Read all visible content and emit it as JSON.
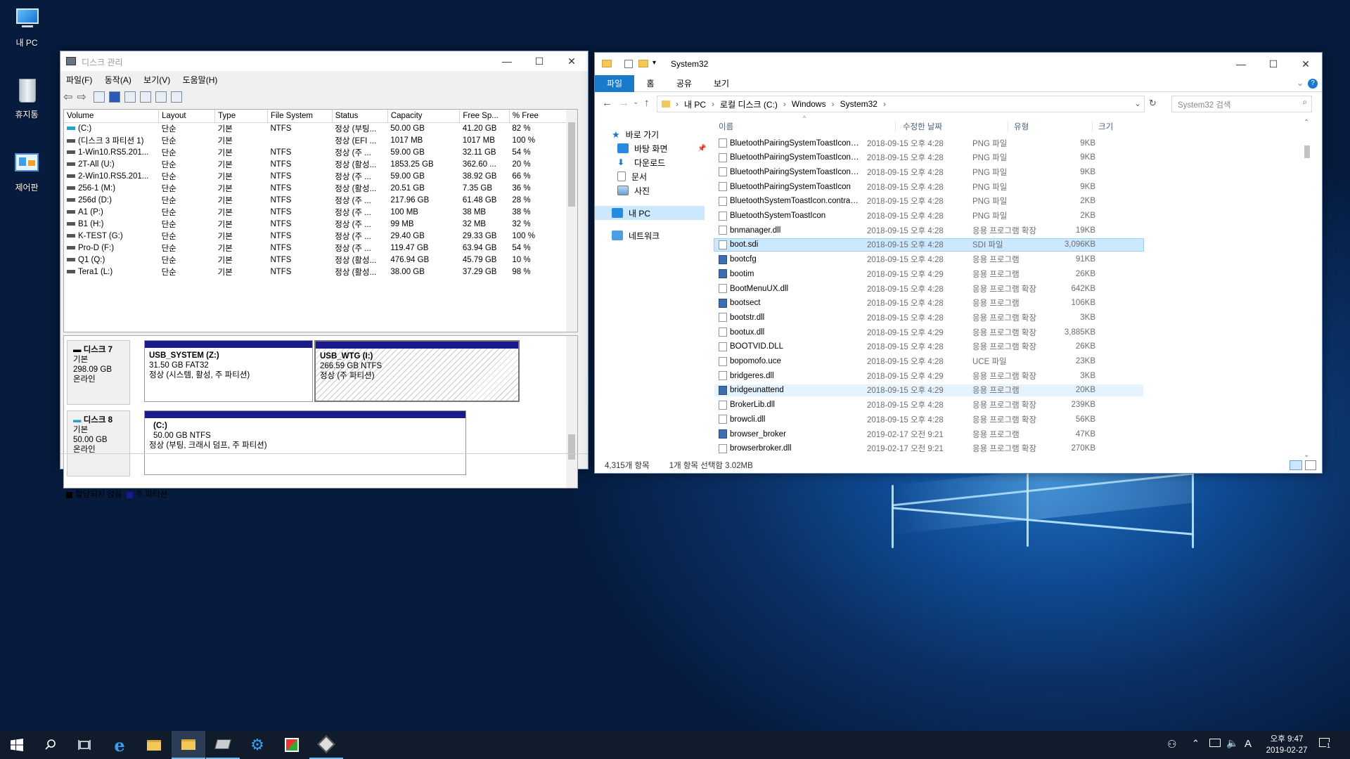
{
  "desktop": {
    "icons": [
      {
        "label": "내 PC",
        "icon": "computer-icon"
      },
      {
        "label": "휴지통",
        "icon": "recycle-bin-icon"
      },
      {
        "label": "제어판",
        "icon": "control-panel-icon"
      }
    ]
  },
  "disk_mgmt": {
    "title": "디스크 관리",
    "menu": [
      "파일(F)",
      "동작(A)",
      "보기(V)",
      "도움말(H)"
    ],
    "columns": [
      "Volume",
      "Layout",
      "Type",
      "File System",
      "Status",
      "Capacity",
      "Free Sp...",
      "% Free"
    ],
    "rows": [
      {
        "volume": "(C:)",
        "layout": "단순",
        "type": "기본",
        "fs": "NTFS",
        "status": "정상 (부팅...",
        "capacity": "50.00 GB",
        "free": "41.20 GB",
        "pct": "82 %"
      },
      {
        "volume": "(디스크 3 파티션 1)",
        "layout": "단순",
        "type": "기본",
        "fs": "",
        "status": "정상 (EFI ...",
        "capacity": "1017 MB",
        "free": "1017 MB",
        "pct": "100 %"
      },
      {
        "volume": "1-Win10.RS5.201...",
        "layout": "단순",
        "type": "기본",
        "fs": "NTFS",
        "status": "정상 (주 ...",
        "capacity": "59.00 GB",
        "free": "32.11 GB",
        "pct": "54 %"
      },
      {
        "volume": "2T-All (U:)",
        "layout": "단순",
        "type": "기본",
        "fs": "NTFS",
        "status": "정상 (활성...",
        "capacity": "1853.25 GB",
        "free": "362.60 ...",
        "pct": "20 %"
      },
      {
        "volume": "2-Win10.RS5.201...",
        "layout": "단순",
        "type": "기본",
        "fs": "NTFS",
        "status": "정상 (주 ...",
        "capacity": "59.00 GB",
        "free": "38.92 GB",
        "pct": "66 %"
      },
      {
        "volume": "256-1 (M:)",
        "layout": "단순",
        "type": "기본",
        "fs": "NTFS",
        "status": "정상 (활성...",
        "capacity": "20.51 GB",
        "free": "7.35 GB",
        "pct": "36 %"
      },
      {
        "volume": "256d (D:)",
        "layout": "단순",
        "type": "기본",
        "fs": "NTFS",
        "status": "정상 (주 ...",
        "capacity": "217.96 GB",
        "free": "61.48 GB",
        "pct": "28 %"
      },
      {
        "volume": "A1 (P:)",
        "layout": "단순",
        "type": "기본",
        "fs": "NTFS",
        "status": "정상 (주 ...",
        "capacity": "100 MB",
        "free": "38 MB",
        "pct": "38 %"
      },
      {
        "volume": "B1 (H:)",
        "layout": "단순",
        "type": "기본",
        "fs": "NTFS",
        "status": "정상 (주 ...",
        "capacity": "99 MB",
        "free": "32 MB",
        "pct": "32 %"
      },
      {
        "volume": "K-TEST (G:)",
        "layout": "단순",
        "type": "기본",
        "fs": "NTFS",
        "status": "정상 (주 ...",
        "capacity": "29.40 GB",
        "free": "29.33 GB",
        "pct": "100 %"
      },
      {
        "volume": "Pro-D (F:)",
        "layout": "단순",
        "type": "기본",
        "fs": "NTFS",
        "status": "정상 (주 ...",
        "capacity": "119.47 GB",
        "free": "63.94 GB",
        "pct": "54 %"
      },
      {
        "volume": "Q1 (Q:)",
        "layout": "단순",
        "type": "기본",
        "fs": "NTFS",
        "status": "정상 (활성...",
        "capacity": "476.94 GB",
        "free": "45.79 GB",
        "pct": "10 %"
      },
      {
        "volume": "Tera1 (L:)",
        "layout": "단순",
        "type": "기본",
        "fs": "NTFS",
        "status": "정상 (활성...",
        "capacity": "38.00 GB",
        "free": "37.29 GB",
        "pct": "98 %"
      }
    ],
    "disks": [
      {
        "name": "디스크 7",
        "kind": "기본",
        "size": "298.09 GB",
        "state": "온라인",
        "parts": [
          {
            "name": "USB_SYSTEM  (Z:)",
            "size": "31.50 GB FAT32",
            "status": "정상 (시스템, 활성, 주 파티션)"
          },
          {
            "name": "USB_WTG  (I:)",
            "size": "266.59 GB NTFS",
            "status": "정상 (주 파티션)"
          }
        ]
      },
      {
        "name": "디스크 8",
        "kind": "기본",
        "size": "50.00 GB",
        "state": "온라인",
        "parts": [
          {
            "name": "(C:)",
            "size": "50.00 GB NTFS",
            "status": "정상 (부팅, 크래시 덤프, 주 파티션)"
          }
        ]
      }
    ],
    "legend": [
      "할당되지 않음",
      "주 파티션"
    ],
    "colors": {
      "unallocated": "#000000",
      "primary": "#1a1a8c"
    }
  },
  "explorer": {
    "title": "System32",
    "ribbon_tabs": [
      "파일",
      "홈",
      "공유",
      "보기"
    ],
    "breadcrumb": [
      "내 PC",
      "로컬 디스크 (C:)",
      "Windows",
      "System32"
    ],
    "search_placeholder": "System32 검색",
    "nav": [
      {
        "label": "바로 가기",
        "icon": "star-icon"
      },
      {
        "label": "바탕 화면",
        "icon": "desktop-icon"
      },
      {
        "label": "다운로드",
        "icon": "download-icon"
      },
      {
        "label": "문서",
        "icon": "document-icon"
      },
      {
        "label": "사진",
        "icon": "picture-icon"
      },
      {
        "label": "내 PC",
        "icon": "computer-icon"
      },
      {
        "label": "네트워크",
        "icon": "network-icon"
      }
    ],
    "columns": [
      "이름",
      "수정한 날짜",
      "유형",
      "크기"
    ],
    "files": [
      {
        "name": "BluetoothPairingSystemToastIcon.contra...",
        "date": "2018-09-15 오후 4:28",
        "type": "PNG 파일",
        "size": "9KB"
      },
      {
        "name": "BluetoothPairingSystemToastIcon.contra...",
        "date": "2018-09-15 오후 4:28",
        "type": "PNG 파일",
        "size": "9KB"
      },
      {
        "name": "BluetoothPairingSystemToastIcon.contra...",
        "date": "2018-09-15 오후 4:28",
        "type": "PNG 파일",
        "size": "9KB"
      },
      {
        "name": "BluetoothPairingSystemToastIcon",
        "date": "2018-09-15 오후 4:28",
        "type": "PNG 파일",
        "size": "9KB"
      },
      {
        "name": "BluetoothSystemToastIcon.contrast-white",
        "date": "2018-09-15 오후 4:28",
        "type": "PNG 파일",
        "size": "2KB"
      },
      {
        "name": "BluetoothSystemToastIcon",
        "date": "2018-09-15 오후 4:28",
        "type": "PNG 파일",
        "size": "2KB"
      },
      {
        "name": "bnmanager.dll",
        "date": "2018-09-15 오후 4:28",
        "type": "응용 프로그램 확장",
        "size": "19KB"
      },
      {
        "name": "boot.sdi",
        "date": "2018-09-15 오후 4:28",
        "type": "SDI 파일",
        "size": "3,096KB"
      },
      {
        "name": "bootcfg",
        "date": "2018-09-15 오후 4:28",
        "type": "응용 프로그램",
        "size": "91KB"
      },
      {
        "name": "bootim",
        "date": "2018-09-15 오후 4:29",
        "type": "응용 프로그램",
        "size": "26KB"
      },
      {
        "name": "BootMenuUX.dll",
        "date": "2018-09-15 오후 4:28",
        "type": "응용 프로그램 확장",
        "size": "642KB"
      },
      {
        "name": "bootsect",
        "date": "2018-09-15 오후 4:28",
        "type": "응용 프로그램",
        "size": "106KB"
      },
      {
        "name": "bootstr.dll",
        "date": "2018-09-15 오후 4:28",
        "type": "응용 프로그램 확장",
        "size": "3KB"
      },
      {
        "name": "bootux.dll",
        "date": "2018-09-15 오후 4:29",
        "type": "응용 프로그램 확장",
        "size": "3,885KB"
      },
      {
        "name": "BOOTVID.DLL",
        "date": "2018-09-15 오후 4:28",
        "type": "응용 프로그램 확장",
        "size": "26KB"
      },
      {
        "name": "bopomofo.uce",
        "date": "2018-09-15 오후 4:28",
        "type": "UCE 파일",
        "size": "23KB"
      },
      {
        "name": "bridgeres.dll",
        "date": "2018-09-15 오후 4:29",
        "type": "응용 프로그램 확장",
        "size": "3KB"
      },
      {
        "name": "bridgeunattend",
        "date": "2018-09-15 오후 4:29",
        "type": "응용 프로그램",
        "size": "20KB"
      },
      {
        "name": "BrokerLib.dll",
        "date": "2018-09-15 오후 4:28",
        "type": "응용 프로그램 확장",
        "size": "239KB"
      },
      {
        "name": "browcli.dll",
        "date": "2018-09-15 오후 4:28",
        "type": "응용 프로그램 확장",
        "size": "56KB"
      },
      {
        "name": "browser_broker",
        "date": "2019-02-17 오전 9:21",
        "type": "응용 프로그램",
        "size": "47KB"
      },
      {
        "name": "browserbroker.dll",
        "date": "2019-02-17 오전 9:21",
        "type": "응용 프로그램 확장",
        "size": "270KB"
      }
    ],
    "selected_index": 7,
    "hover_index": 17,
    "status_count": "4,315개 항목",
    "status_selected": "1개 항목 선택함 3.02MB",
    "colors": {
      "accent": "#1979ca",
      "selected": "#cce8ff"
    }
  },
  "taskbar": {
    "time": "오후 9:47",
    "date": "2019-02-27",
    "ime": "A",
    "notification_count": "1"
  }
}
